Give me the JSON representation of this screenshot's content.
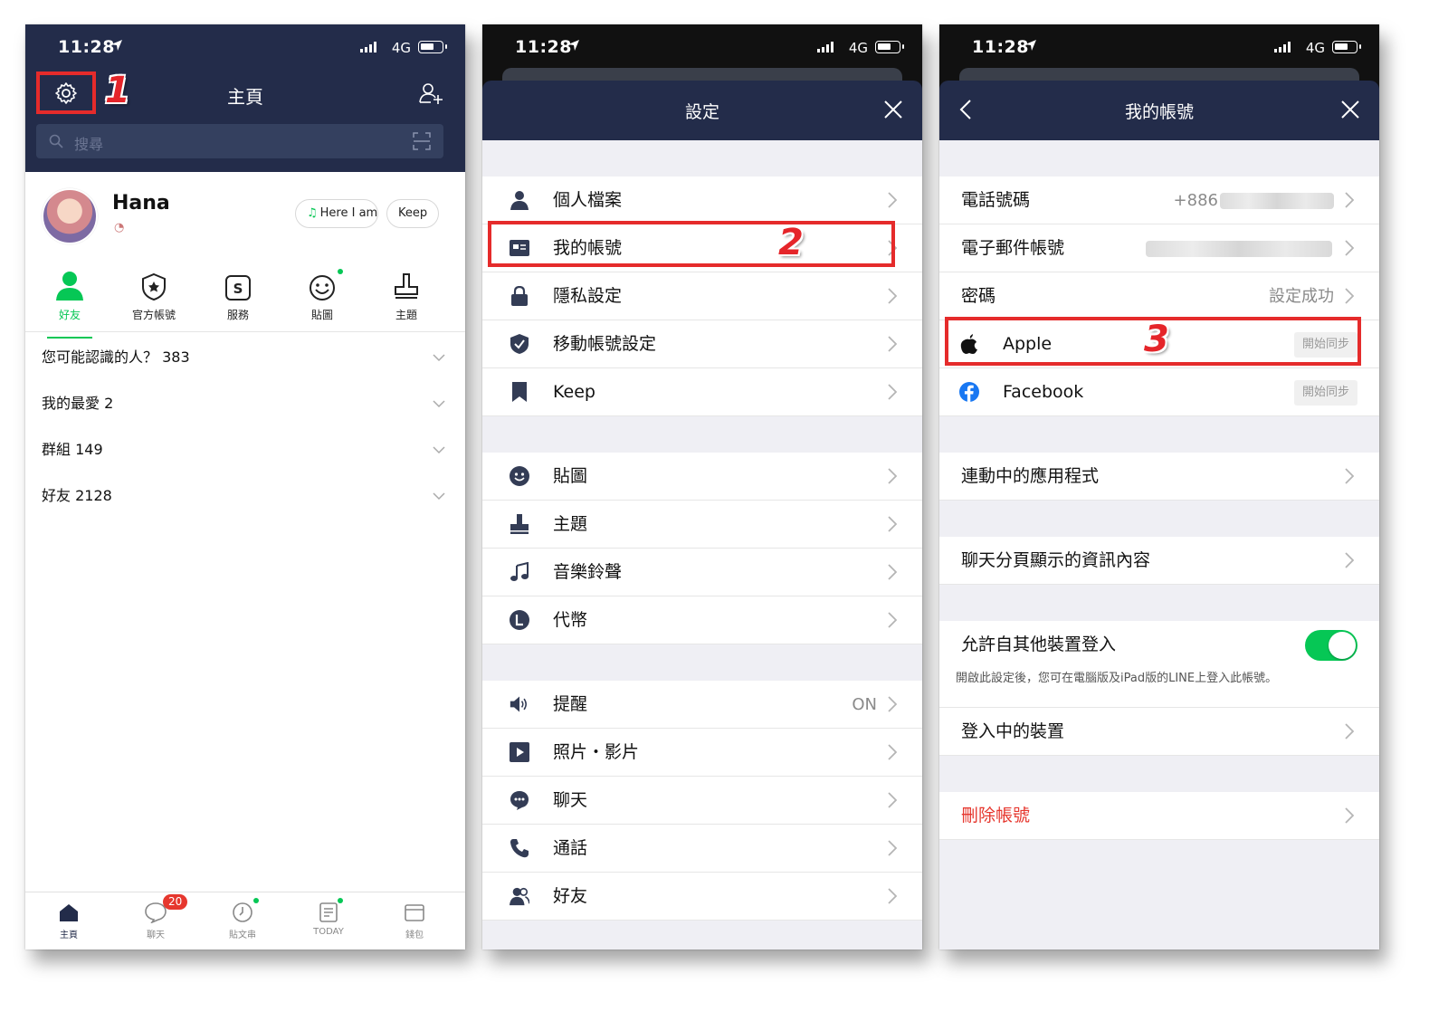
{
  "status_bar": {
    "time": "11:28",
    "network": "4G"
  },
  "screen1": {
    "title": "主頁",
    "step_label": "1",
    "search_placeholder": "搜尋",
    "profile": {
      "name": "Hana",
      "music_chip": "Here I am",
      "keep_chip": "Keep"
    },
    "tabs": [
      {
        "label": "好友",
        "icon": "person-icon",
        "active": true
      },
      {
        "label": "官方帳號",
        "icon": "official-shield-icon"
      },
      {
        "label": "服務",
        "icon": "services-icon"
      },
      {
        "label": "貼圖",
        "icon": "smiley-icon"
      },
      {
        "label": "主題",
        "icon": "theme-brush-icon"
      }
    ],
    "groups": [
      {
        "label": "您可能認識的人？ 383"
      },
      {
        "label": "我的最愛 2"
      },
      {
        "label": "群組 149"
      },
      {
        "label": "好友 2128"
      }
    ],
    "bottom_nav": [
      {
        "label": "主頁",
        "icon": "home-icon",
        "active": true
      },
      {
        "label": "聊天",
        "icon": "chat-icon",
        "badge": "20"
      },
      {
        "label": "貼文串",
        "icon": "clock-icon"
      },
      {
        "label": "TODAY",
        "icon": "news-icon"
      },
      {
        "label": "錢包",
        "icon": "wallet-icon"
      }
    ]
  },
  "screen2": {
    "title": "設定",
    "step_label": "2",
    "sections": [
      [
        {
          "label": "個人檔案",
          "icon": "person-icon"
        },
        {
          "label": "我的帳號",
          "icon": "id-card-icon"
        },
        {
          "label": "隱私設定",
          "icon": "lock-icon"
        },
        {
          "label": "移動帳號設定",
          "icon": "shield-check-icon"
        },
        {
          "label": "Keep",
          "icon": "bookmark-icon"
        }
      ],
      [
        {
          "label": "貼圖",
          "icon": "smiley-icon"
        },
        {
          "label": "主題",
          "icon": "theme-brush-icon"
        },
        {
          "label": "音樂鈴聲",
          "icon": "music-note-icon"
        },
        {
          "label": "代幣",
          "icon": "coin-icon"
        }
      ],
      [
        {
          "label": "提醒",
          "icon": "speaker-icon",
          "value": "ON"
        },
        {
          "label": "照片・影片",
          "icon": "play-icon"
        },
        {
          "label": "聊天",
          "icon": "chat-bubble-icon"
        },
        {
          "label": "通話",
          "icon": "phone-icon"
        },
        {
          "label": "好友",
          "icon": "friends-icon"
        }
      ]
    ]
  },
  "screen3": {
    "title": "我的帳號",
    "step_label": "3",
    "phone": {
      "label": "電話號碼",
      "value": "+886"
    },
    "email": {
      "label": "電子郵件帳號"
    },
    "password": {
      "label": "密碼",
      "value": "設定成功"
    },
    "apple": {
      "label": "Apple",
      "button": "開始同步"
    },
    "facebook": {
      "label": "Facebook",
      "button": "開始同步"
    },
    "linked_apps": "連動中的應用程式",
    "chat_tab_info": "聊天分頁顯示的資訊內容",
    "allow_login": {
      "label": "允許自其他裝置登入",
      "enabled": true,
      "note": "開啟此設定後，您可在電腦版及iPad版的LINE上登入此帳號。"
    },
    "logged_devices": "登入中的裝置",
    "delete_account": "刪除帳號"
  },
  "colors": {
    "header": "#232c4a",
    "accent_green": "#06c755",
    "highlight_red": "#e52b2b",
    "danger": "#e6372e"
  }
}
